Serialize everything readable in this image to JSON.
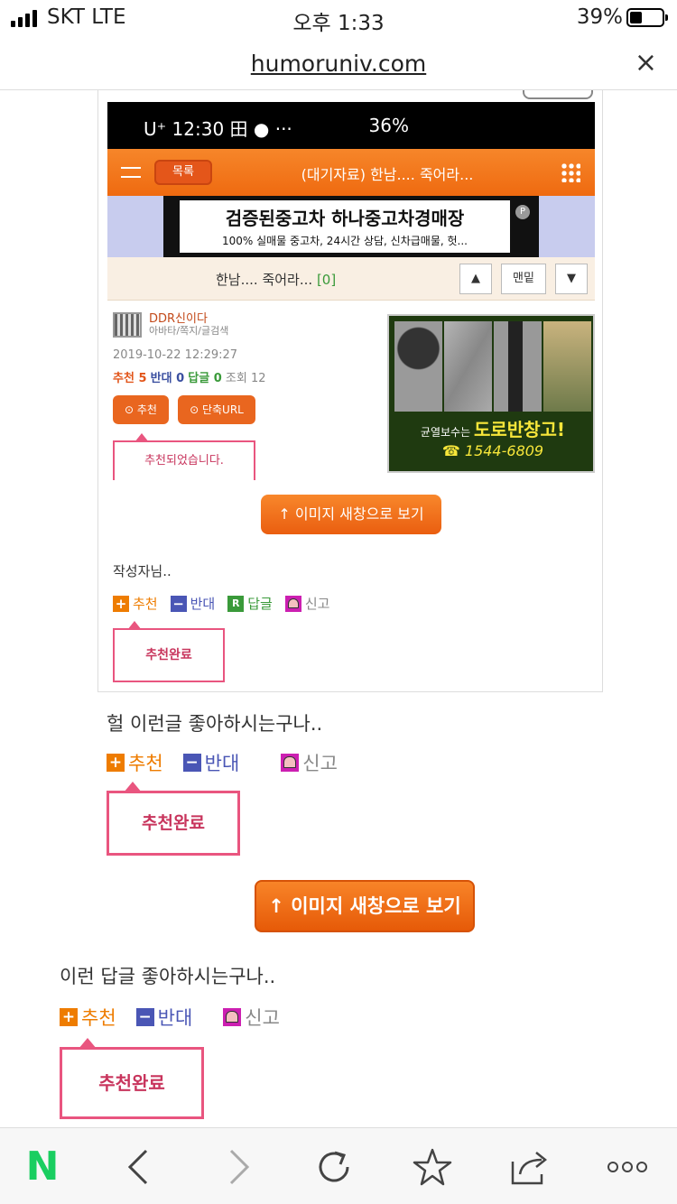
{
  "status_bar": {
    "carrier": "SKT  LTE",
    "time": "오후 1:33",
    "battery": "39%"
  },
  "browser": {
    "url": "humoruniv.com",
    "close_glyph": "×"
  },
  "screenshot": {
    "phone_status_left": "U⁺ 12:30 田 ● ···",
    "phone_status_right": "36%",
    "header": {
      "list_button": "목록",
      "title": "(대기자료) 한남.... 죽어라..."
    },
    "ad": {
      "title": "검증된중고차 하나중고차경매장",
      "subtitle": "100% 실매물 중고차, 24시간 상담, 신차급매물, 헛...",
      "badge": "P"
    },
    "nav": {
      "subject": "한남.... 죽어라...",
      "count": "[0]",
      "up": "▲",
      "latest": "맨밑",
      "down": "▼"
    },
    "post": {
      "author": "DDR신이다",
      "author_sub": "아바타/쪽지/글검색",
      "date": "2019-10-22 12:29:27",
      "stats_up": "추천 5",
      "stats_down": "반대 0",
      "stats_reply": "답글 0",
      "stats_view": "조회 12",
      "recommend_button": "⊙ 추천",
      "short_url_button": "⊙ 단축URL",
      "recommended_msg": "추천되었습니다."
    },
    "road_ad": {
      "prefix": "균열보수는 ",
      "brand": "도로반창고!",
      "phone": "☎ 1544-6809"
    },
    "open_image_button": "↑ 이미지 새창으로 보기",
    "author_note": "작성자님..",
    "actions": {
      "up": "추천",
      "down": "반대",
      "reply": "답글",
      "report": "신고"
    },
    "done": "추천완료"
  },
  "comment1": {
    "text": "헐 이런글 좋아하시는구나..",
    "up": "추천",
    "down": "반대",
    "report": "신고",
    "done": "추천완료"
  },
  "open_image_button": "↑ 이미지 새창으로 보기",
  "comment2": {
    "text": "이런 답글 좋아하시는구나..",
    "up": "추천",
    "down": "반대",
    "report": "신고",
    "done": "추천완료"
  },
  "bottom_bar": {
    "home_logo": "N",
    "icons": [
      "back-icon",
      "forward-icon",
      "reload-icon",
      "bookmark-star-icon",
      "share-icon",
      "more-icon"
    ]
  }
}
